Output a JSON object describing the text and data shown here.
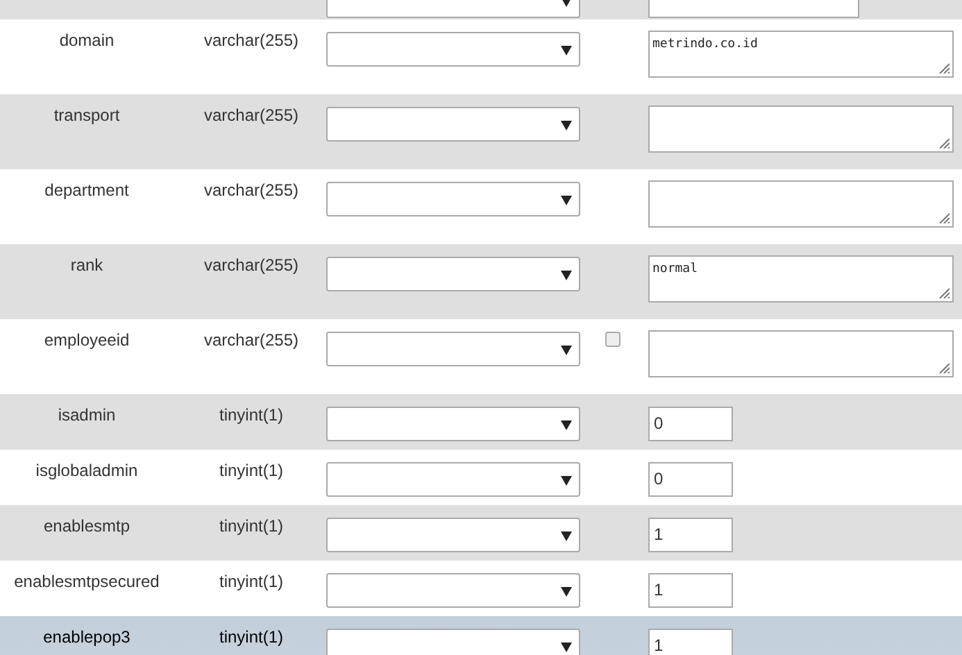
{
  "rows": [
    {
      "clipped": true,
      "kind": "input",
      "highlighted": false
    },
    {
      "clipped": false,
      "name": "domain",
      "type": "varchar(255)",
      "kind": "textarea",
      "value": "metrindo.co.id",
      "highlighted": false
    },
    {
      "clipped": false,
      "name": "transport",
      "type": "varchar(255)",
      "kind": "textarea",
      "highlighted": false
    },
    {
      "clipped": false,
      "name": "department",
      "type": "varchar(255)",
      "kind": "textarea",
      "highlighted": false
    },
    {
      "clipped": false,
      "name": "rank",
      "type": "varchar(255)",
      "kind": "textarea",
      "value": "normal",
      "highlighted": false
    },
    {
      "clipped": false,
      "name": "employeeid",
      "type": "varchar(255)",
      "kind": "textarea",
      "highlighted": false,
      "null_checkbox": {
        "checked": false
      }
    },
    {
      "clipped": false,
      "name": "isadmin",
      "type": "tinyint(1)",
      "kind": "input",
      "value": "0",
      "highlighted": false
    },
    {
      "clipped": false,
      "name": "isglobaladmin",
      "type": "tinyint(1)",
      "kind": "input",
      "value": "0",
      "highlighted": false
    },
    {
      "clipped": false,
      "name": "enablesmtp",
      "type": "tinyint(1)",
      "kind": "input",
      "value": "1",
      "highlighted": false
    },
    {
      "clipped": false,
      "name": "enablesmtpsecured",
      "type": "tinyint(1)",
      "kind": "input",
      "value": "1",
      "highlighted": false
    },
    {
      "clipped": false,
      "name": "enablepop3",
      "type": "tinyint(1)",
      "kind": "input",
      "value": "1",
      "highlighted": true
    }
  ]
}
